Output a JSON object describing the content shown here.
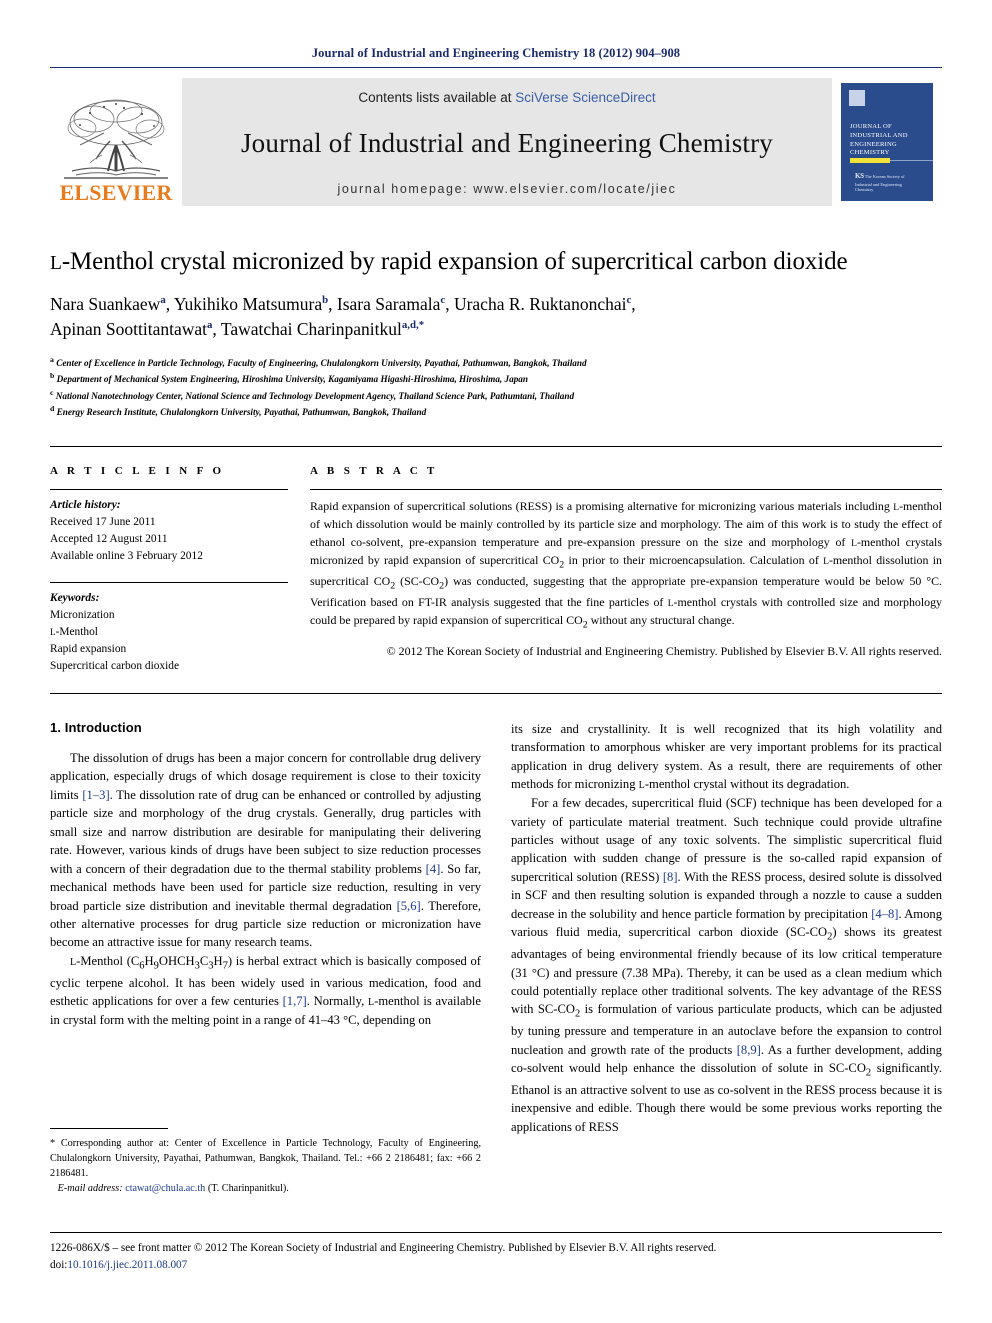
{
  "running_head": "Journal of Industrial and Engineering Chemistry 18 (2012) 904–908",
  "banner": {
    "publisher_name": "ELSEVIER",
    "contents_prefix": "Contents lists available at ",
    "contents_link": "SciVerse ScienceDirect",
    "journal_title": "Journal of Industrial and Engineering Chemistry",
    "homepage": "journal homepage: www.elsevier.com/locate/jiec",
    "cover": {
      "title": "JOURNAL OF INDUSTRIAL AND ENGINEERING CHEMISTRY",
      "society": "The Korean Society of Industrial and Engineering Chemistry"
    }
  },
  "article": {
    "title_prefix": "L",
    "title_rest": "-Menthol crystal micronized by rapid expansion of supercritical carbon dioxide",
    "authors_line1": "Nara Suankaew a, Yukihiko Matsumura b, Isara Saramala c, Uracha R. Ruktanonchai c,",
    "authors_line2": "Apinan Soottitantawat a, Tawatchai Charinpanitkul a,d,*",
    "authors": [
      {
        "name": "Nara Suankaew",
        "sup": "a",
        "sep": ", "
      },
      {
        "name": "Yukihiko Matsumura",
        "sup": "b",
        "sep": ", "
      },
      {
        "name": "Isara Saramala",
        "sup": "c",
        "sep": ", "
      },
      {
        "name": "Uracha R. Ruktanonchai",
        "sup": "c",
        "sep": ","
      },
      {
        "name": "Apinan Soottitantawat",
        "sup": "a",
        "sep": ", "
      },
      {
        "name": "Tawatchai Charinpanitkul",
        "sup": "a,d,*",
        "sep": ""
      }
    ],
    "affiliations": [
      {
        "mark": "a",
        "text": "Center of Excellence in Particle Technology, Faculty of Engineering, Chulalongkorn University, Payathai, Pathumwan, Bangkok, Thailand"
      },
      {
        "mark": "b",
        "text": "Department of Mechanical System Engineering, Hiroshima University, Kagamiyama Higashi-Hiroshima, Hiroshima, Japan"
      },
      {
        "mark": "c",
        "text": "National Nanotechnology Center, National Science and Technology Development Agency, Thailand Science Park, Pathumtani, Thailand"
      },
      {
        "mark": "d",
        "text": "Energy Research Institute, Chulalongkorn University, Payathai, Pathumwan, Bangkok, Thailand"
      }
    ]
  },
  "article_info": {
    "heading": "A R T I C L E  I N F O",
    "history_label": "Article history:",
    "history": [
      "Received 17 June 2011",
      "Accepted 12 August 2011",
      "Available online 3 February 2012"
    ],
    "keywords_label": "Keywords:",
    "keywords": [
      "Micronization",
      "L-Menthol",
      "Rapid expansion",
      "Supercritical carbon dioxide"
    ]
  },
  "abstract": {
    "heading": "A B S T R A C T",
    "body": "Rapid expansion of supercritical solutions (RESS) is a promising alternative for micronizing various materials including L-menthol of which dissolution would be mainly controlled by its particle size and morphology. The aim of this work is to study the effect of ethanol co-solvent, pre-expansion temperature and pre-expansion pressure on the size and morphology of L-menthol crystals micronized by rapid expansion of supercritical CO2 in prior to their microencapsulation. Calculation of L-menthol dissolution in supercritical CO2 (SC-CO2) was conducted, suggesting that the appropriate pre-expansion temperature would be below 50 °C. Verification based on FT-IR analysis suggested that the fine particles of L-menthol crystals with controlled size and morphology could be prepared by rapid expansion of supercritical CO2 without any structural change.",
    "copyright": "© 2012 The Korean Society of Industrial and Engineering Chemistry. Published by Elsevier B.V. All rights reserved."
  },
  "sections": {
    "intro_heading": "1. Introduction",
    "left_paragraphs": [
      "The dissolution of drugs has been a major concern for controllable drug delivery application, especially drugs of which dosage requirement is close to their toxicity limits [1–3]. The dissolution rate of drug can be enhanced or controlled by adjusting particle size and morphology of the drug crystals. Generally, drug particles with small size and narrow distribution are desirable for manipulating their delivering rate. However, various kinds of drugs have been subject to size reduction processes with a concern of their degradation due to the thermal stability problems [4]. So far, mechanical methods have been used for particle size reduction, resulting in very broad particle size distribution and inevitable thermal degradation [5,6]. Therefore, other alternative processes for drug particle size reduction or micronization have become an attractive issue for many research teams.",
      "L-Menthol (C6H9OHCH3C3H7) is herbal extract which is basically composed of cyclic terpene alcohol. It has been widely used in various medication, food and esthetic applications for over a few centuries [1,7]. Normally, L-menthol is available in crystal form with the melting point in a range of 41–43 °C, depending on"
    ],
    "right_paragraphs": [
      "its size and crystallinity. It is well recognized that its high volatility and transformation to amorphous whisker are very important problems for its practical application in drug delivery system. As a result, there are requirements of other methods for micronizing L-menthol crystal without its degradation.",
      "For a few decades, supercritical fluid (SCF) technique has been developed for a variety of particulate material treatment. Such technique could provide ultrafine particles without usage of any toxic solvents. The simplistic supercritical fluid application with sudden change of pressure is the so-called rapid expansion of supercritical solution (RESS) [8]. With the RESS process, desired solute is dissolved in SCF and then resulting solution is expanded through a nozzle to cause a sudden decrease in the solubility and hence particle formation by precipitation [4–8]. Among various fluid media, supercritical carbon dioxide (SC-CO2) shows its greatest advantages of being environmental friendly because of its low critical temperature (31 °C) and pressure (7.38 MPa). Thereby, it can be used as a clean medium which could potentially replace other traditional solvents. The key advantage of the RESS with SC-CO2 is formulation of various particulate products, which can be adjusted by tuning pressure and temperature in an autoclave before the expansion to control nucleation and growth rate of the products [8,9]. As a further development, adding co-solvent would help enhance the dissolution of solute in SC-CO2 significantly. Ethanol is an attractive solvent to use as co-solvent in the RESS process because it is inexpensive and edible. Though there would be some previous works reporting the applications of RESS"
    ]
  },
  "footnote": {
    "corresponding": "* Corresponding author at: Center of Excellence in Particle Technology, Faculty of Engineering, Chulalongkorn University, Payathai, Pathumwan, Bangkok, Thailand. Tel.: +66 2 2186481; fax: +66 2 2186481.",
    "email_label": "E-mail address:",
    "email": "ctawat@chula.ac.th",
    "email_suffix": "(T. Charinpanitkul)."
  },
  "bottom": {
    "front_matter": "1226-086X/$ – see front matter © 2012 The Korean Society of Industrial and Engineering Chemistry. Published by Elsevier B.V. All rights reserved.",
    "doi_label": "doi:",
    "doi": "10.1016/j.jiec.2011.08.007"
  },
  "colors": {
    "header_blue": "#1a2b6d",
    "link_blue": "#1a3a8f",
    "elsevier_orange": "#E87B1E",
    "banner_gray": "#e6e6e6",
    "cover_blue": "#2b4c8c",
    "cover_yellow": "#f2e23a"
  }
}
